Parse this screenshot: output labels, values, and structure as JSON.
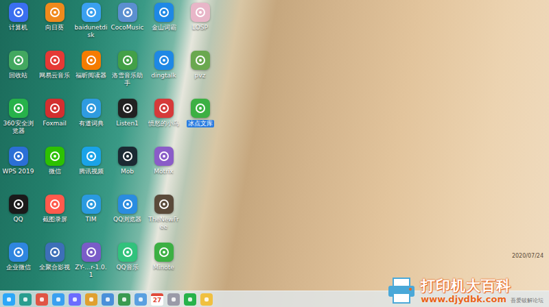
{
  "desktop": {
    "icons": [
      {
        "label": "计算机",
        "color": "#3a6ff0",
        "selected": false
      },
      {
        "label": "回收站",
        "color": "#43a860",
        "selected": false
      },
      {
        "label": "360安全浏览器",
        "color": "#27b24a",
        "selected": false
      },
      {
        "label": "WPS 2019",
        "color": "#2b6fd6",
        "selected": false
      },
      {
        "label": "QQ",
        "color": "#1a1a1a",
        "selected": false
      },
      {
        "label": "企业微信",
        "color": "#2f86e0",
        "selected": false
      },
      {
        "label": "向日葵",
        "color": "#f08a1c",
        "selected": false
      },
      {
        "label": "网易云音乐",
        "color": "#e53935",
        "selected": false
      },
      {
        "label": "Foxmail",
        "color": "#d32f2f",
        "selected": false
      },
      {
        "label": "微信",
        "color": "#2dc100",
        "selected": false
      },
      {
        "label": "截图录屏",
        "color": "#ff5a4c",
        "selected": false
      },
      {
        "label": "全聚合影视",
        "color": "#3d6fb8",
        "selected": false
      },
      {
        "label": "baidunetdisk",
        "color": "#3aa0f0",
        "selected": false
      },
      {
        "label": "福昕阅读器",
        "color": "#f57c00",
        "selected": false
      },
      {
        "label": "有道词典",
        "color": "#2f9be0",
        "selected": false
      },
      {
        "label": "腾讯视频",
        "color": "#1aa3e8",
        "selected": false
      },
      {
        "label": "TIM",
        "color": "#2a9ae0",
        "selected": false
      },
      {
        "label": "ZY-…r-1.0.1",
        "color": "#7a5cc8",
        "selected": false
      },
      {
        "label": "CocoMusic",
        "color": "#5b8fd0",
        "selected": false
      },
      {
        "label": "洛雪音乐助手",
        "color": "#43a047",
        "selected": false
      },
      {
        "label": "Listen1",
        "color": "#222222",
        "selected": false
      },
      {
        "label": "Mob",
        "color": "#1b2a33",
        "selected": false
      },
      {
        "label": "QQ浏览器",
        "color": "#2a8ce0",
        "selected": false
      },
      {
        "label": "QQ音乐",
        "color": "#31c27c",
        "selected": false
      },
      {
        "label": "金山词霸",
        "color": "#1e88e5",
        "selected": false
      },
      {
        "label": "dingtalk",
        "color": "#1e88e5",
        "selected": false
      },
      {
        "label": "愤怒的小鸟",
        "color": "#d63a3a",
        "selected": false
      },
      {
        "label": "Motrix",
        "color": "#8a5cc8",
        "selected": false
      },
      {
        "label": "TheNewFree",
        "color": "#5a4a3a",
        "selected": false
      },
      {
        "label": "Minote",
        "color": "#3cb043",
        "selected": false
      },
      {
        "label": "LOSP",
        "color": "#e8b6c8",
        "selected": false
      },
      {
        "label": "pvz",
        "color": "#6aa84f",
        "selected": false
      },
      {
        "label": "冰点文库",
        "color": "#3cb043",
        "selected": true
      }
    ]
  },
  "date": "2020/07/24",
  "taskbar": {
    "items": [
      {
        "kind": "app",
        "color": "#2ca7f8"
      },
      {
        "kind": "app",
        "color": "#2a9d8f"
      },
      {
        "kind": "app",
        "color": "#e05545"
      },
      {
        "kind": "app",
        "color": "#3aa0f0"
      },
      {
        "kind": "app",
        "color": "#6c6cff"
      },
      {
        "kind": "app",
        "color": "#e0a030"
      },
      {
        "kind": "app",
        "color": "#4a90d9"
      },
      {
        "kind": "app",
        "color": "#3a9a50"
      },
      {
        "kind": "app",
        "color": "#5aa0e0"
      },
      {
        "kind": "calendar",
        "color": "#e04a3a",
        "day": "27"
      },
      {
        "kind": "app",
        "color": "#9a9aa8"
      },
      {
        "kind": "app",
        "color": "#27b24a"
      },
      {
        "kind": "app",
        "color": "#f0c040"
      }
    ]
  },
  "watermark": {
    "title": "打印机大百科",
    "url": "www.djydbk.com",
    "forum": "吾爱破解论坛"
  }
}
